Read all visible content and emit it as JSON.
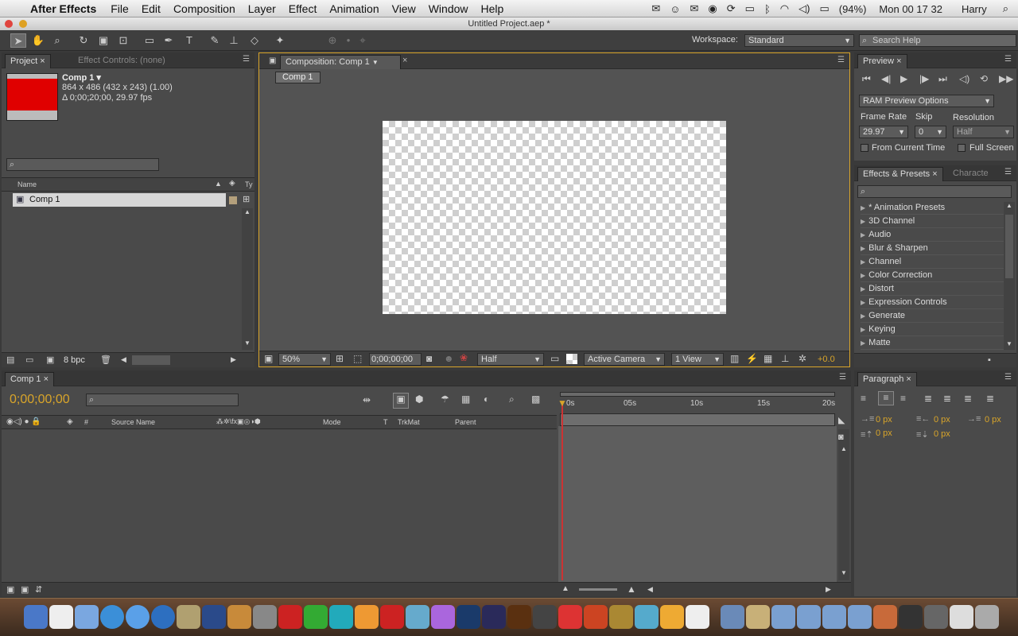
{
  "menubar": {
    "app_name": "After Effects",
    "items": [
      "File",
      "Edit",
      "Composition",
      "Layer",
      "Effect",
      "Animation",
      "View",
      "Window",
      "Help"
    ],
    "battery": "(94%)",
    "clock": "Mon 00 17 32",
    "user": "Harry"
  },
  "window": {
    "title": "Untitled Project.aep *"
  },
  "toolbar": {
    "workspace_label": "Workspace:",
    "workspace_value": "Standard",
    "search_placeholder": "Search Help"
  },
  "project": {
    "tab_project": "Project",
    "tab_effect_controls": "Effect Controls: (none)",
    "comp_name": "Comp 1 ▾",
    "comp_size": "864 x 486  (432 x 243) (1.00)",
    "comp_duration": "Δ 0;00;20;00, 29.97 fps",
    "col_name": "Name",
    "col_type": "Ty",
    "item_name": "Comp 1",
    "bpc": "8 bpc",
    "thumb_color": "#e00000"
  },
  "composition": {
    "tab_label": "Composition: Comp 1",
    "flow_label": "Comp 1",
    "zoom": "50%",
    "timecode": "0;00;00;00",
    "resolution": "Half",
    "camera": "Active Camera",
    "views": "1 View",
    "exposure": "+0.0"
  },
  "preview": {
    "tab": "Preview",
    "ram_options": "RAM Preview Options",
    "frame_rate_label": "Frame Rate",
    "skip_label": "Skip",
    "resolution_label": "Resolution",
    "frame_rate": "29.97",
    "skip": "0",
    "resolution": "Half",
    "from_current": "From Current Time",
    "full_screen": "Full Screen"
  },
  "effects": {
    "tab": "Effects & Presets",
    "tab2": "Characte",
    "items": [
      "* Animation Presets",
      "3D Channel",
      "Audio",
      "Blur & Sharpen",
      "Channel",
      "Color Correction",
      "Distort",
      "Expression Controls",
      "Generate",
      "Keying",
      "Matte"
    ]
  },
  "timeline": {
    "tab": "Comp 1",
    "timecode": "0;00;00;00",
    "col_hash": "#",
    "col_source": "Source Name",
    "col_mode": "Mode",
    "col_t": "T",
    "col_trkmat": "TrkMat",
    "col_parent": "Parent",
    "ruler": [
      "0s",
      "05s",
      "10s",
      "15s",
      "20s"
    ]
  },
  "paragraph": {
    "tab": "Paragraph",
    "values": [
      "0 px",
      "0 px",
      "0 px",
      "0 px",
      "0 px"
    ]
  }
}
